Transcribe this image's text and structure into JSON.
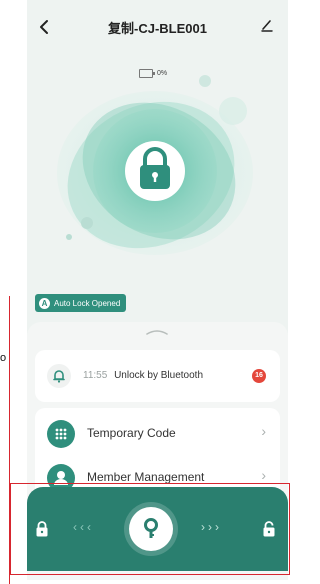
{
  "header": {
    "title": "复制-CJ-BLE001",
    "back_icon": "chevron-left-icon",
    "edit_icon": "pencil-icon"
  },
  "battery": {
    "percent_text": "0%",
    "level": 0
  },
  "auto_lock": {
    "badge_letter": "A",
    "label": "Auto Lock Opened"
  },
  "log": {
    "time": "11:55",
    "text": "Unlock by Bluetooth",
    "count": "16"
  },
  "menu": {
    "items": [
      {
        "label": "Temporary Code",
        "icon": "keypad-icon"
      },
      {
        "label": "Member Management",
        "icon": "person-icon"
      }
    ]
  },
  "controls": {
    "left_arrows": "‹‹‹",
    "right_arrows": "›››",
    "lock_icon": "lock-icon",
    "unlock_icon": "unlock-icon",
    "key_icon": "key-icon"
  },
  "side_glyph": "o",
  "colors": {
    "accent": "#2f8f7d",
    "bar": "#2a7f6f",
    "badge_red": "#e4473b",
    "frame_red": "#d7262f"
  }
}
